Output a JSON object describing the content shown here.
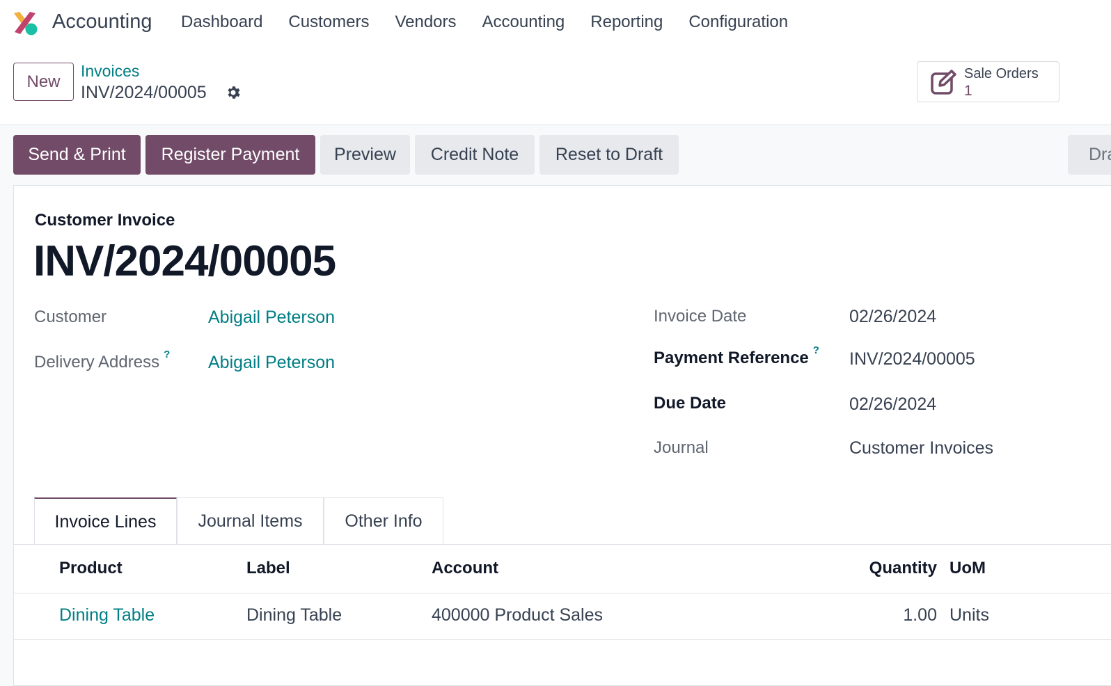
{
  "navbar": {
    "app_name": "Accounting",
    "menu": [
      "Dashboard",
      "Customers",
      "Vendors",
      "Accounting",
      "Reporting",
      "Configuration"
    ]
  },
  "control": {
    "new_label": "New",
    "breadcrumb_parent": "Invoices",
    "breadcrumb_current": "INV/2024/00005",
    "smart_button": {
      "label": "Sale Orders",
      "count": "1"
    }
  },
  "actions": {
    "send_print": "Send & Print",
    "register_payment": "Register Payment",
    "preview": "Preview",
    "credit_note": "Credit Note",
    "reset_to_draft": "Reset to Draft",
    "status_partial": "Dra"
  },
  "sheet": {
    "doc_type": "Customer Invoice",
    "doc_name": "INV/2024/00005",
    "left_fields": {
      "customer_label": "Customer",
      "customer_value": "Abigail Peterson",
      "delivery_label": "Delivery Address",
      "delivery_value": "Abigail Peterson",
      "help_mark": "?"
    },
    "right_fields": {
      "invoice_date_label": "Invoice Date",
      "invoice_date_value": "02/26/2024",
      "payment_ref_label": "Payment Reference",
      "payment_ref_value": "INV/2024/00005",
      "due_date_label": "Due Date",
      "due_date_value": "02/26/2024",
      "journal_label": "Journal",
      "journal_value": "Customer Invoices"
    },
    "tabs": [
      "Invoice Lines",
      "Journal Items",
      "Other Info"
    ],
    "table": {
      "headers": {
        "product": "Product",
        "label": "Label",
        "account": "Account",
        "quantity": "Quantity",
        "uom": "UoM"
      },
      "rows": [
        {
          "product": "Dining Table",
          "label": "Dining Table",
          "account": "400000 Product Sales",
          "quantity": "1.00",
          "uom": "Units"
        }
      ]
    }
  },
  "colors": {
    "brand": "#714b67",
    "link": "#017e84"
  }
}
